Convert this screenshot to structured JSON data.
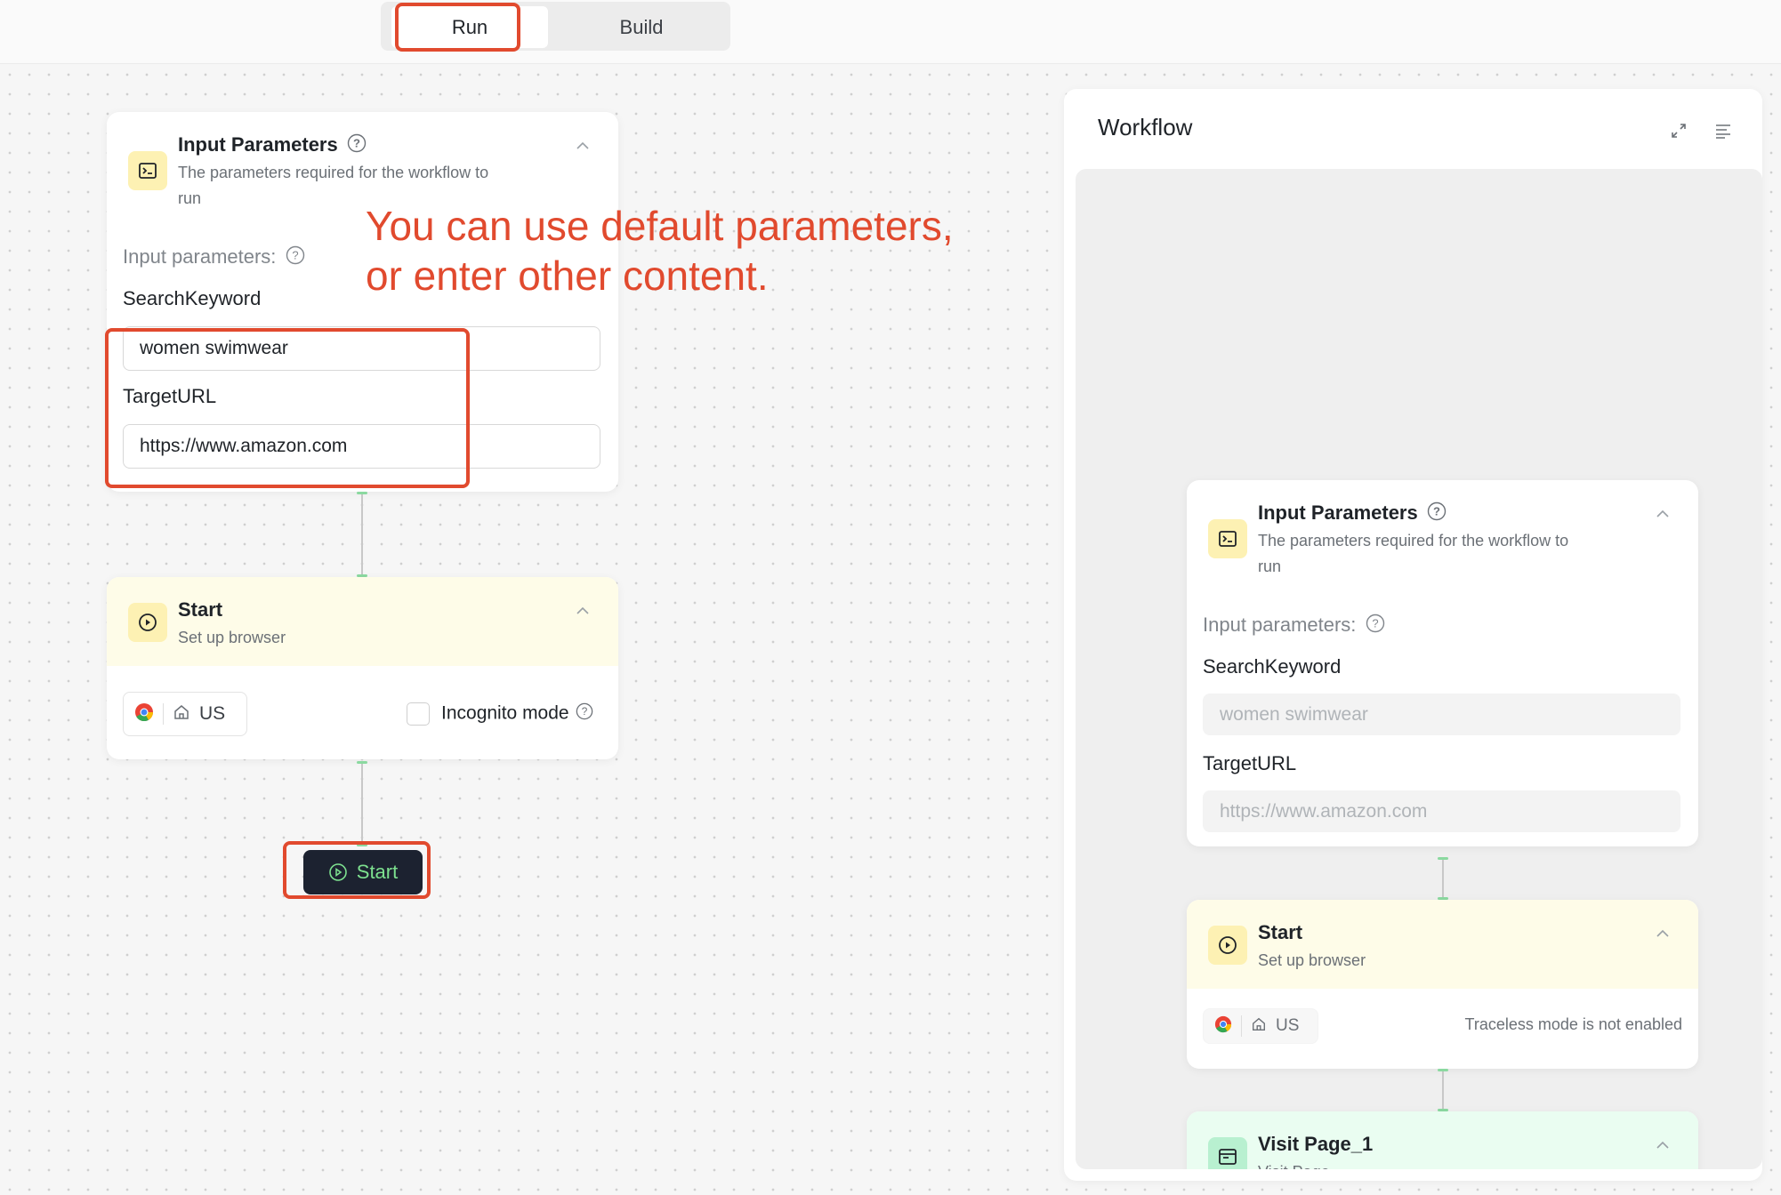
{
  "tabs": {
    "run": "Run",
    "build": "Build"
  },
  "annotation": {
    "line1": "You can use default parameters,",
    "line2": "or enter other content."
  },
  "left": {
    "input_node": {
      "title": "Input Parameters",
      "desc_line1": "The parameters required for the workflow to",
      "desc_line2": "run",
      "params_label": "Input parameters:",
      "param1_label": "SearchKeyword",
      "param1_value": "women swimwear",
      "param2_label": "TargetURL",
      "param2_value": "https://www.amazon.com"
    },
    "start_node": {
      "title": "Start",
      "desc": "Set up browser",
      "region": "US",
      "incognito_label": "Incognito mode"
    },
    "start_button": "Start"
  },
  "workflow": {
    "title": "Workflow",
    "input_node": {
      "title": "Input Parameters",
      "desc_line1": "The parameters required for the workflow to",
      "desc_line2": "run",
      "params_label": "Input parameters:",
      "param1_label": "SearchKeyword",
      "param1_value": "women swimwear",
      "param2_label": "TargetURL",
      "param2_value": "https://www.amazon.com"
    },
    "start_node": {
      "title": "Start",
      "desc": "Set up browser",
      "region": "US",
      "traceless_text": "Traceless mode is not enabled"
    },
    "visit_node": {
      "title": "Visit Page_1",
      "desc": "Visit Page"
    }
  },
  "colors": {
    "highlight": "#e14a2e",
    "start_button_bg": "#1c2230",
    "start_button_text": "#7de08f"
  }
}
